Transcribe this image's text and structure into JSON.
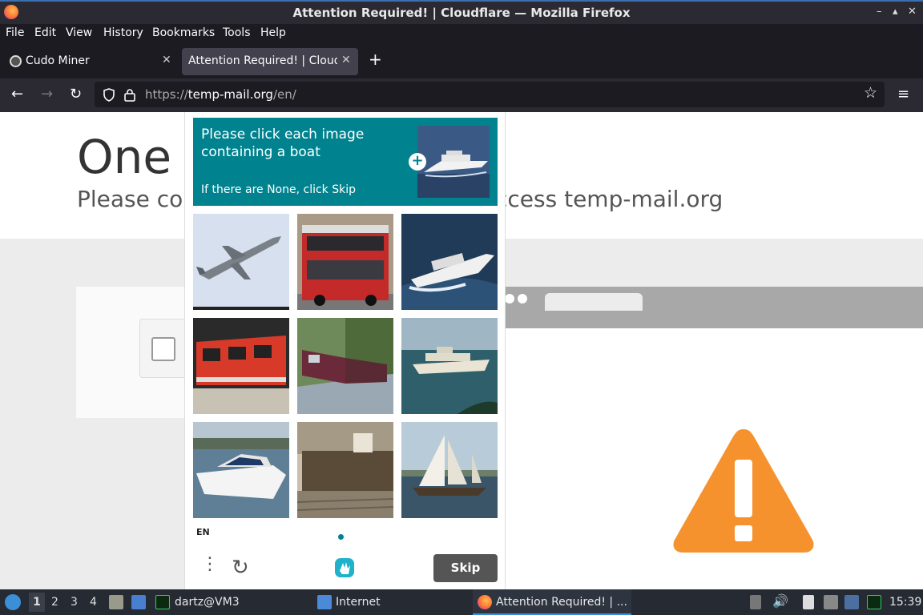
{
  "window": {
    "title": "Attention Required! | Cloudflare — Mozilla Firefox",
    "controls": [
      "–",
      "▴",
      "✕"
    ]
  },
  "menu": [
    "File",
    "Edit",
    "View",
    "History",
    "Bookmarks",
    "Tools",
    "Help"
  ],
  "tabs": [
    {
      "label": "Cudo Miner",
      "close": "✕"
    },
    {
      "label": "Attention Required! | Cloudfl",
      "close": "✕"
    }
  ],
  "nav": {
    "url_prefix": "https://",
    "url_host": "temp-mail.org",
    "url_path": "/en/"
  },
  "page": {
    "heading": "One m",
    "subtitle_left": "Please cor",
    "subtitle_right": "ccess temp-mail.org"
  },
  "captcha": {
    "prompt": "Please click each image containing a boat",
    "hint": "If there are None, click Skip",
    "images": [
      "airplane",
      "red double-decker bus",
      "speedboat",
      "red train",
      "freight train",
      "cruise ship",
      "motorboat",
      "cargo ship",
      "sailboat"
    ],
    "language": "EN",
    "skip_label": "Skip"
  },
  "taskbar": {
    "workspaces": [
      "1",
      "2",
      "3",
      "4"
    ],
    "items": [
      "dartz@VM3",
      "Internet",
      "Attention Required! | ..."
    ],
    "clock": "15:39"
  },
  "colors": {
    "captcha_header": "#00838f",
    "warning": "#f6922e",
    "skip_button": "#555555"
  }
}
